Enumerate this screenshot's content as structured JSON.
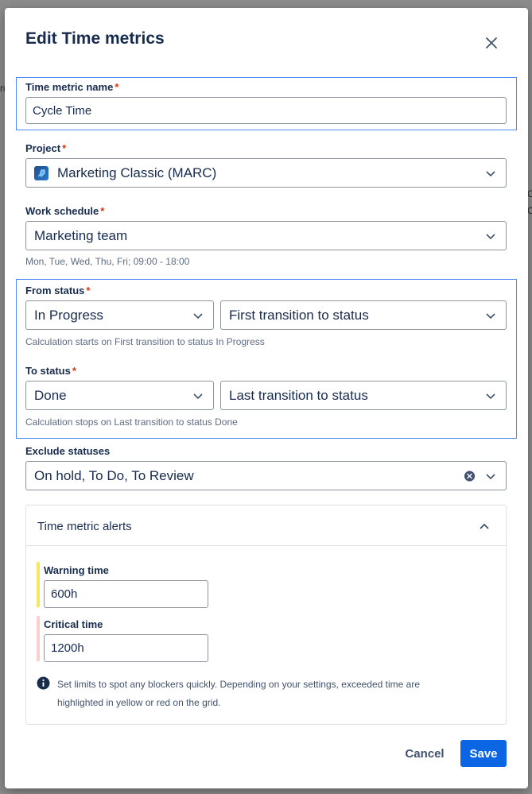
{
  "dialog": {
    "title": "Edit Time metrics"
  },
  "name_field": {
    "label": "Time metric name",
    "value": "Cycle Time"
  },
  "project_field": {
    "label": "Project",
    "value": "Marketing Classic (MARC)"
  },
  "schedule_field": {
    "label": "Work schedule",
    "value": "Marketing team",
    "help": "Mon, Tue, Wed, Thu, Fri; 09:00 - 18:00"
  },
  "from_status": {
    "label": "From status",
    "status": "In Progress",
    "transition": "First transition to status",
    "help": "Calculation starts on First transition to status In Progress"
  },
  "to_status": {
    "label": "To status",
    "status": "Done",
    "transition": "Last transition to status",
    "help": "Calculation stops on Last transition to status Done"
  },
  "exclude_field": {
    "label": "Exclude statuses",
    "value": "On hold, To Do, To Review"
  },
  "alerts": {
    "title": "Time metric alerts",
    "warning_label": "Warning time",
    "warning_value": "600h",
    "critical_label": "Critical time",
    "critical_value": "1200h",
    "info_line1": "Set limits to spot any blockers quickly. Depending on your settings, exceeded time are",
    "info_line2": "highlighted in yellow or red on the grid."
  },
  "footer": {
    "cancel_label": "Cancel",
    "save_label": "Save"
  },
  "colors": {
    "accent": "#0c66e4",
    "focus_outline": "#4c8bf5",
    "required": "#de350b",
    "warning": "#f5e663",
    "critical": "#f9d0cc"
  }
}
